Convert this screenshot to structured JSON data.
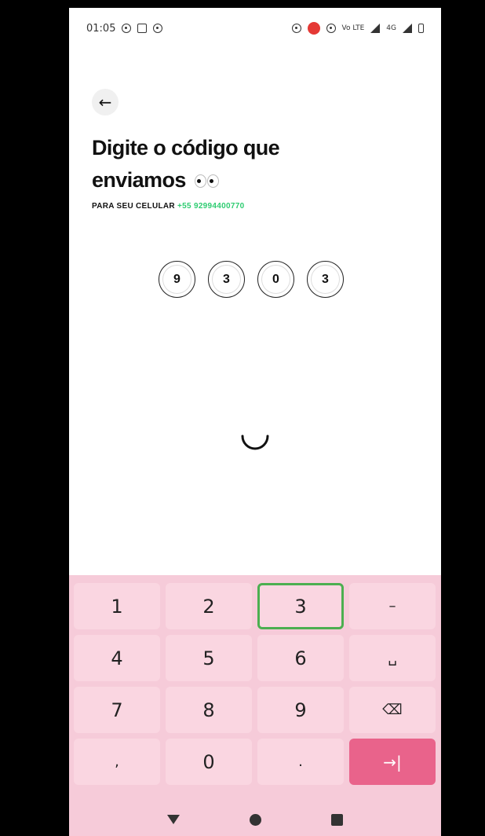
{
  "status_bar": {
    "time": "01:05",
    "network_small": "Vo LTE",
    "network": "4G"
  },
  "header": {
    "title_line1": "Digite o código que",
    "title_line2": "enviamos",
    "subtitle_prefix": "PARA SEU CELULAR",
    "subtitle_phone": "+55 92994400770"
  },
  "code": {
    "digits": [
      "9",
      "3",
      "0",
      "3"
    ]
  },
  "keyboard": {
    "keys": [
      {
        "label": "1",
        "type": "digit"
      },
      {
        "label": "2",
        "type": "digit"
      },
      {
        "label": "3",
        "type": "digit",
        "pressed": true
      },
      {
        "label": "–",
        "type": "side"
      },
      {
        "label": "4",
        "type": "digit"
      },
      {
        "label": "5",
        "type": "digit"
      },
      {
        "label": "6",
        "type": "digit"
      },
      {
        "label": "␣",
        "type": "side"
      },
      {
        "label": "7",
        "type": "digit"
      },
      {
        "label": "8",
        "type": "digit"
      },
      {
        "label": "9",
        "type": "digit"
      },
      {
        "label": "⌫",
        "type": "side"
      },
      {
        "label": ",",
        "type": "side"
      },
      {
        "label": "0",
        "type": "digit"
      },
      {
        "label": ".",
        "type": "side"
      },
      {
        "label": "→|",
        "type": "enter"
      }
    ]
  },
  "colors": {
    "accent_green": "#2ecc71",
    "keyboard_bg": "#f6cbd9",
    "key_bg": "#fad6e1",
    "enter_key": "#e9638b",
    "pressed_outline": "#4caf50"
  }
}
